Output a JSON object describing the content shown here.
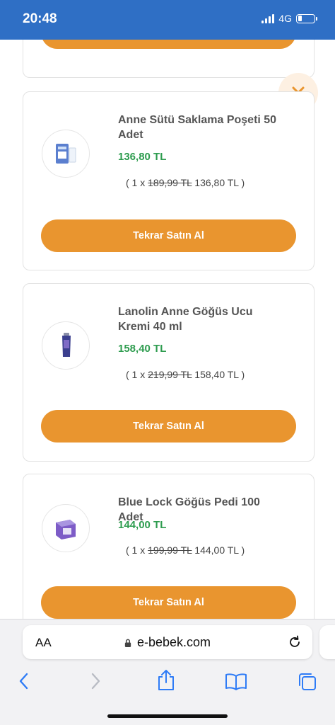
{
  "status": {
    "time": "20:48",
    "network": "4G"
  },
  "cart": {
    "rebuy_label": "Tekrar Satın Al",
    "items": [
      {
        "title": "Anne Sütü Saklama Poşeti 50 Adet",
        "price": "136,80 TL",
        "qty_prefix": "( 1 x",
        "old_price": "189,99 TL",
        "unit_price": "136,80 TL )"
      },
      {
        "title": "Lanolin Anne Göğüs Ucu Kremi 40 ml",
        "price": "158,40 TL",
        "qty_prefix": "( 1 x",
        "old_price": "219,99 TL",
        "unit_price": "158,40 TL )"
      },
      {
        "title": "Blue Lock Göğüs Pedi 100 Adet",
        "price": "144,00 TL",
        "qty_prefix": "( 1 x",
        "old_price": "199,99 TL",
        "unit_price": "144,00 TL )"
      }
    ]
  },
  "browser": {
    "aa_label": "AA",
    "url": "e-bebek.com"
  },
  "colors": {
    "accent": "#e9952f",
    "price_green": "#2e9c4f",
    "status_blue": "#2f6fc5",
    "ios_blue": "#2f7cf6"
  },
  "icons": [
    "signal-icon",
    "battery-icon",
    "close-icon",
    "lock-icon",
    "reload-icon",
    "back-icon",
    "forward-icon",
    "share-icon",
    "bookmarks-icon",
    "tabs-icon"
  ]
}
